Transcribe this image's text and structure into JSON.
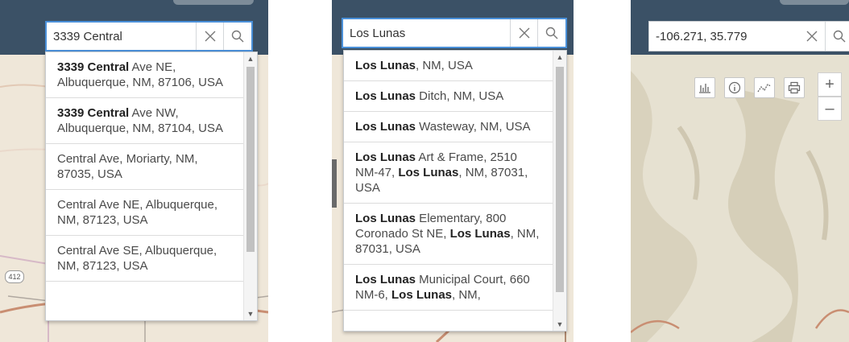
{
  "panels": [
    {
      "search": {
        "value": "3339 Central",
        "placeholder": ""
      },
      "suggestions": [
        {
          "parts": [
            {
              "text": "3339 Central",
              "bold": true
            },
            {
              "text": " Ave NE, Albuquerque, NM, 87106, USA",
              "bold": false
            }
          ]
        },
        {
          "parts": [
            {
              "text": "3339 Central",
              "bold": true
            },
            {
              "text": " Ave NW, Albuquerque, NM, 87104, USA",
              "bold": false
            }
          ]
        },
        {
          "parts": [
            {
              "text": "Central Ave, Moriarty, NM, 87035, USA",
              "bold": false
            }
          ]
        },
        {
          "parts": [
            {
              "text": "Central Ave NE, Albuquerque, NM, 87123, USA",
              "bold": false
            }
          ]
        },
        {
          "parts": [
            {
              "text": "Central Ave SE, Albuquerque, NM, 87123, USA",
              "bold": false
            }
          ]
        }
      ],
      "map_labels": {
        "route": "412"
      }
    },
    {
      "search": {
        "value": "Los Lunas",
        "placeholder": ""
      },
      "suggestions": [
        {
          "parts": [
            {
              "text": "Los Lunas",
              "bold": true
            },
            {
              "text": ", NM, USA",
              "bold": false
            }
          ]
        },
        {
          "parts": [
            {
              "text": "Los Lunas",
              "bold": true
            },
            {
              "text": " Ditch, NM, USA",
              "bold": false
            }
          ]
        },
        {
          "parts": [
            {
              "text": "Los Lunas",
              "bold": true
            },
            {
              "text": " Wasteway, NM, USA",
              "bold": false
            }
          ]
        },
        {
          "parts": [
            {
              "text": "Los Lunas",
              "bold": true
            },
            {
              "text": " Art & Frame, 2510 NM-47, ",
              "bold": false
            },
            {
              "text": "Los Lunas",
              "bold": true
            },
            {
              "text": ", NM, 87031, USA",
              "bold": false
            }
          ]
        },
        {
          "parts": [
            {
              "text": "Los Lunas",
              "bold": true
            },
            {
              "text": " Elementary, 800 Coronado St NE, ",
              "bold": false
            },
            {
              "text": "Los Lunas",
              "bold": true
            },
            {
              "text": ", NM, 87031, USA",
              "bold": false
            }
          ]
        },
        {
          "parts": [
            {
              "text": "Los Lunas",
              "bold": true
            },
            {
              "text": " Municipal Court, 660 NM-6, ",
              "bold": false
            },
            {
              "text": "Los Lunas",
              "bold": true
            },
            {
              "text": ", NM,",
              "bold": false
            }
          ]
        }
      ]
    },
    {
      "search": {
        "value": "-106.271, 35.779",
        "placeholder": ""
      },
      "tools": [
        {
          "name": "chart-icon"
        },
        {
          "name": "info-icon"
        },
        {
          "name": "profile-line-icon"
        },
        {
          "name": "print-icon"
        }
      ],
      "zoom": {
        "in_label": "+",
        "out_label": "–"
      }
    }
  ],
  "colors": {
    "header": "#3b5166",
    "focus": "#4a90d9",
    "map_base": "#efe7d9",
    "terrain": "#e6e1d1"
  }
}
